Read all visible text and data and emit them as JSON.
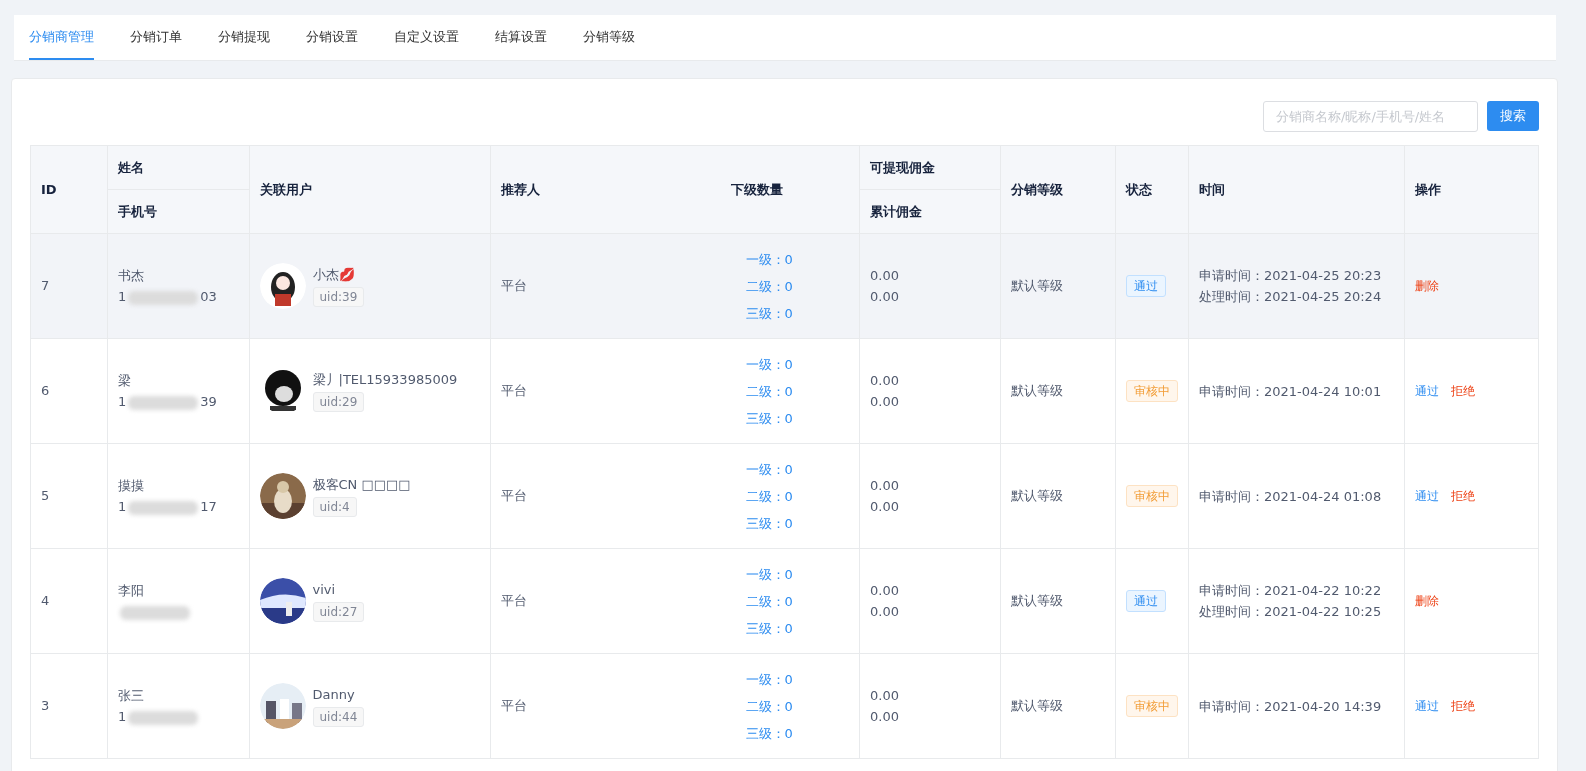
{
  "tabs": [
    {
      "label": "分销商管理",
      "selected": true
    },
    {
      "label": "分销订单",
      "selected": false
    },
    {
      "label": "分销提现",
      "selected": false
    },
    {
      "label": "分销设置",
      "selected": false
    },
    {
      "label": "自定义设置",
      "selected": false
    },
    {
      "label": "结算设置",
      "selected": false
    },
    {
      "label": "分销等级",
      "selected": false
    }
  ],
  "search": {
    "placeholder": "分销商名称/昵称/手机号/姓名",
    "button": "搜索"
  },
  "table": {
    "headers": {
      "id": "ID",
      "name": "姓名",
      "phone": "手机号",
      "user": "关联用户",
      "referrer": "推荐人",
      "downline": "下级数量",
      "withdrawable": "可提现佣金",
      "total": "累计佣金",
      "level": "分销等级",
      "status": "状态",
      "time": "时间",
      "actions": "操作"
    },
    "rows": [
      {
        "id": "7",
        "name": "书杰",
        "phone_start": "1",
        "phone_end": "03",
        "nickname": "小杰💋",
        "uid": "uid:39",
        "referrer": "平台",
        "downline": [
          "一级：0",
          "二级：0",
          "三级：0"
        ],
        "withdrawable": "0.00",
        "total": "0.00",
        "level": "默认等级",
        "status": {
          "kind": "approved",
          "label": "通过"
        },
        "times": [
          "申请时间：2021-04-25 20:23",
          "处理时间：2021-04-25 20:24"
        ],
        "actions": [
          {
            "kind": "delete",
            "label": "删除"
          }
        ],
        "highlighted": true
      },
      {
        "id": "6",
        "name": "梁",
        "phone_start": "1",
        "phone_end": "39",
        "nickname": "梁丿|TEL15933985009",
        "uid": "uid:29",
        "referrer": "平台",
        "downline": [
          "一级：0",
          "二级：0",
          "三级：0"
        ],
        "withdrawable": "0.00",
        "total": "0.00",
        "level": "默认等级",
        "status": {
          "kind": "pending",
          "label": "审核中"
        },
        "times": [
          "申请时间：2021-04-24 10:01"
        ],
        "actions": [
          {
            "kind": "approve",
            "label": "通过"
          },
          {
            "kind": "reject",
            "label": "拒绝"
          }
        ],
        "highlighted": false
      },
      {
        "id": "5",
        "name": "摸摸",
        "phone_start": "1",
        "phone_end": "17",
        "nickname": "极客CN □□□□",
        "uid": "uid:4",
        "referrer": "平台",
        "downline": [
          "一级：0",
          "二级：0",
          "三级：0"
        ],
        "withdrawable": "0.00",
        "total": "0.00",
        "level": "默认等级",
        "status": {
          "kind": "pending",
          "label": "审核中"
        },
        "times": [
          "申请时间：2021-04-24 01:08"
        ],
        "actions": [
          {
            "kind": "approve",
            "label": "通过"
          },
          {
            "kind": "reject",
            "label": "拒绝"
          }
        ],
        "highlighted": false
      },
      {
        "id": "4",
        "name": "李阳",
        "nickname": "vivi",
        "uid": "uid:27",
        "referrer": "平台",
        "downline": [
          "一级：0",
          "二级：0",
          "三级：0"
        ],
        "withdrawable": "0.00",
        "total": "0.00",
        "level": "默认等级",
        "status": {
          "kind": "approved",
          "label": "通过"
        },
        "times": [
          "申请时间：2021-04-22 10:22",
          "处理时间：2021-04-22 10:25"
        ],
        "actions": [
          {
            "kind": "delete",
            "label": "删除"
          }
        ],
        "highlighted": false
      },
      {
        "id": "3",
        "name": "张三",
        "phone_start": "1",
        "nickname": "Danny",
        "uid": "uid:44",
        "referrer": "平台",
        "downline": [
          "一级：0",
          "二级：0",
          "三级：0"
        ],
        "withdrawable": "0.00",
        "total": "0.00",
        "level": "默认等级",
        "status": {
          "kind": "pending",
          "label": "审核中"
        },
        "times": [
          "申请时间：2021-04-20 14:39"
        ],
        "actions": [
          {
            "kind": "approve",
            "label": "通过"
          },
          {
            "kind": "reject",
            "label": "拒绝"
          }
        ],
        "highlighted": false
      }
    ]
  }
}
